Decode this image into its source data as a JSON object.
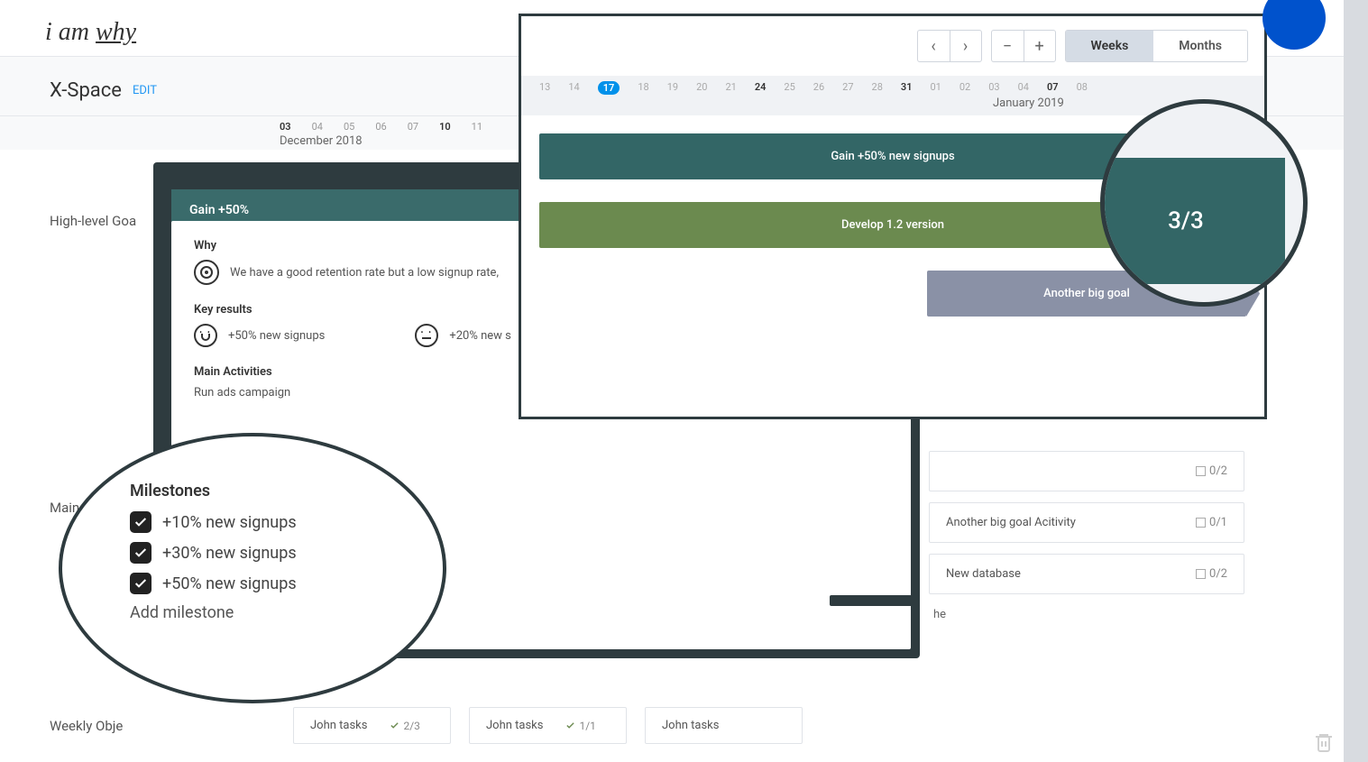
{
  "brand": {
    "prefix": "i am ",
    "suffix": "why"
  },
  "space": {
    "name": "X-Space",
    "edit": "EDIT"
  },
  "timeline_small": {
    "month": "December 2018",
    "days": [
      "03",
      "04",
      "05",
      "06",
      "07",
      "10",
      "11"
    ]
  },
  "sections": {
    "goals": "High-level Goa",
    "main": "Main",
    "weekly": "Weekly Obje"
  },
  "modal": {
    "title": "Gain +50%",
    "why_label": "Why",
    "why_text": "We have a good retention rate but a low signup rate,",
    "kr_label": "Key results",
    "kr1": "+50% new signups",
    "kr2": "+20% new s",
    "act_label": "Main Activities",
    "act1": "Run ads campaign"
  },
  "milestones_zoom": {
    "title": "Milestones",
    "items": [
      "+10% new signups",
      "+30% new signups",
      "+50% new signups"
    ],
    "add": "Add milestone"
  },
  "timeline_panel": {
    "prev": "‹",
    "next": "›",
    "minus": "−",
    "plus": "+",
    "weeks": "Weeks",
    "months": "Months",
    "days": [
      "13",
      "14",
      "17",
      "18",
      "19",
      "20",
      "21",
      "24",
      "25",
      "26",
      "27",
      "28",
      "31",
      "01",
      "02",
      "03",
      "04",
      "07",
      "08"
    ],
    "today_idx": 2,
    "bold_idx": [
      7,
      12,
      17
    ],
    "month": "January 2019",
    "goal1": "Gain +50% new signups",
    "goal2": "Develop 1.2 version",
    "goal3": "Another big goal"
  },
  "counter_zoom": "3/3",
  "activities": [
    {
      "label": "",
      "count": "0/2"
    },
    {
      "label": "Another big goal Acitivity",
      "count": "0/1"
    },
    {
      "label": "New database",
      "count": "0/2"
    }
  ],
  "partial_text": "he",
  "weekly_tasks": [
    {
      "label": "John tasks",
      "count": "2/3"
    },
    {
      "label": "John tasks",
      "count": "1/1"
    },
    {
      "label": "John tasks",
      "count": ""
    }
  ]
}
